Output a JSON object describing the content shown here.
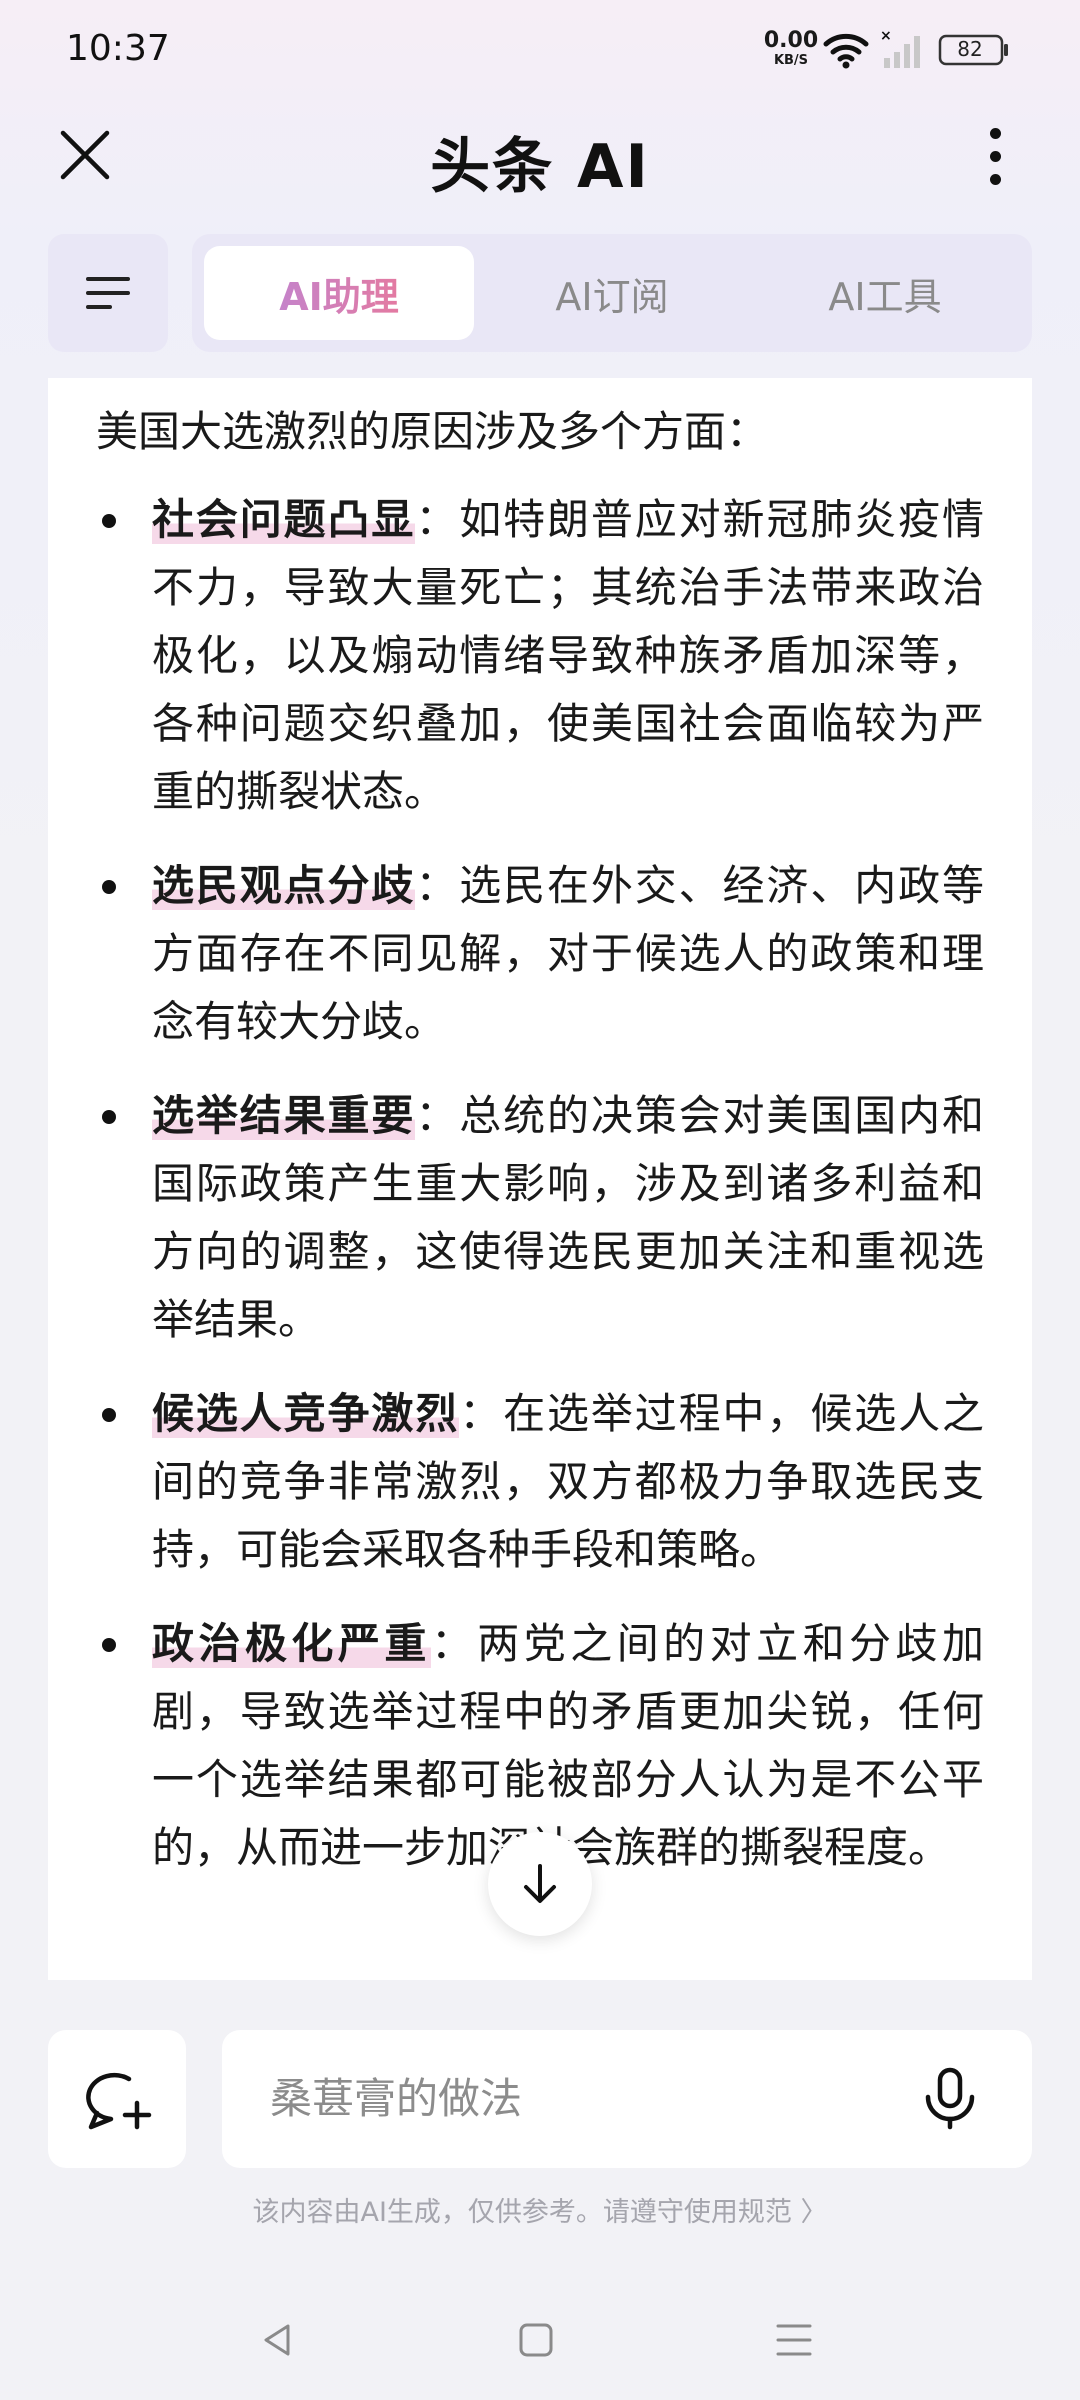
{
  "status_bar": {
    "time": "10:37",
    "net_speed": "0.00",
    "net_unit": "KB/S",
    "battery": "82"
  },
  "header": {
    "title": "头条 AI"
  },
  "tabs": [
    {
      "label": "AI助理",
      "active": true
    },
    {
      "label": "AI订阅",
      "active": false
    },
    {
      "label": "AI工具",
      "active": false
    }
  ],
  "content": {
    "intro": "美国大选激烈的原因涉及多个方面：",
    "points": [
      {
        "term": "社会问题凸显",
        "text": "：如特朗普应对新冠肺炎疫情不力，导致大量死亡；其统治手法带来政治极化，以及煽动情绪导致种族矛盾加深等，各种问题交织叠加，使美国社会面临较为严重的撕裂状态。"
      },
      {
        "term": "选民观点分歧",
        "text": "：选民在外交、经济、内政等方面存在不同见解，对于候选人的政策和理念有较大分歧。"
      },
      {
        "term": "选举结果重要",
        "text": "：总统的决策会对美国国内和国际政策产生重大影响，涉及到诸多利益和方向的调整，这使得选民更加关注和重视选举结果。"
      },
      {
        "term": "候选人竞争激烈",
        "text": "：在选举过程中，候选人之间的竞争非常激烈，双方都极力争取选民支持，可能会采取各种手段和策略。"
      },
      {
        "term": "政治极化严重",
        "text": "：两党之间的对立和分歧加剧，导致选举过程中的矛盾更加尖锐，任何一个选举结果都可能被部分人认为是不公平的，从而进一步加深社会族群的撕裂程度。"
      }
    ]
  },
  "input": {
    "placeholder": "桑葚膏的做法"
  },
  "footer": {
    "disclaimer": "该内容由AI生成，仅供参考。请遵守使用规范 〉"
  },
  "colors": {
    "accent_gradient_start": "#c583ca",
    "accent_gradient_end": "#e37aa1",
    "tab_bar_bg": "#e9e7f6",
    "highlight": "#f6d9e9"
  },
  "icons": {
    "close": "close-icon",
    "more": "more-vertical-icon",
    "menu": "menu-lines-icon",
    "scroll_down": "arrow-down-icon",
    "new_chat": "chat-plus-icon",
    "mic": "mic-icon",
    "nav_back": "triangle-back-icon",
    "nav_home": "square-home-icon",
    "nav_menu": "menu-lines-icon"
  }
}
